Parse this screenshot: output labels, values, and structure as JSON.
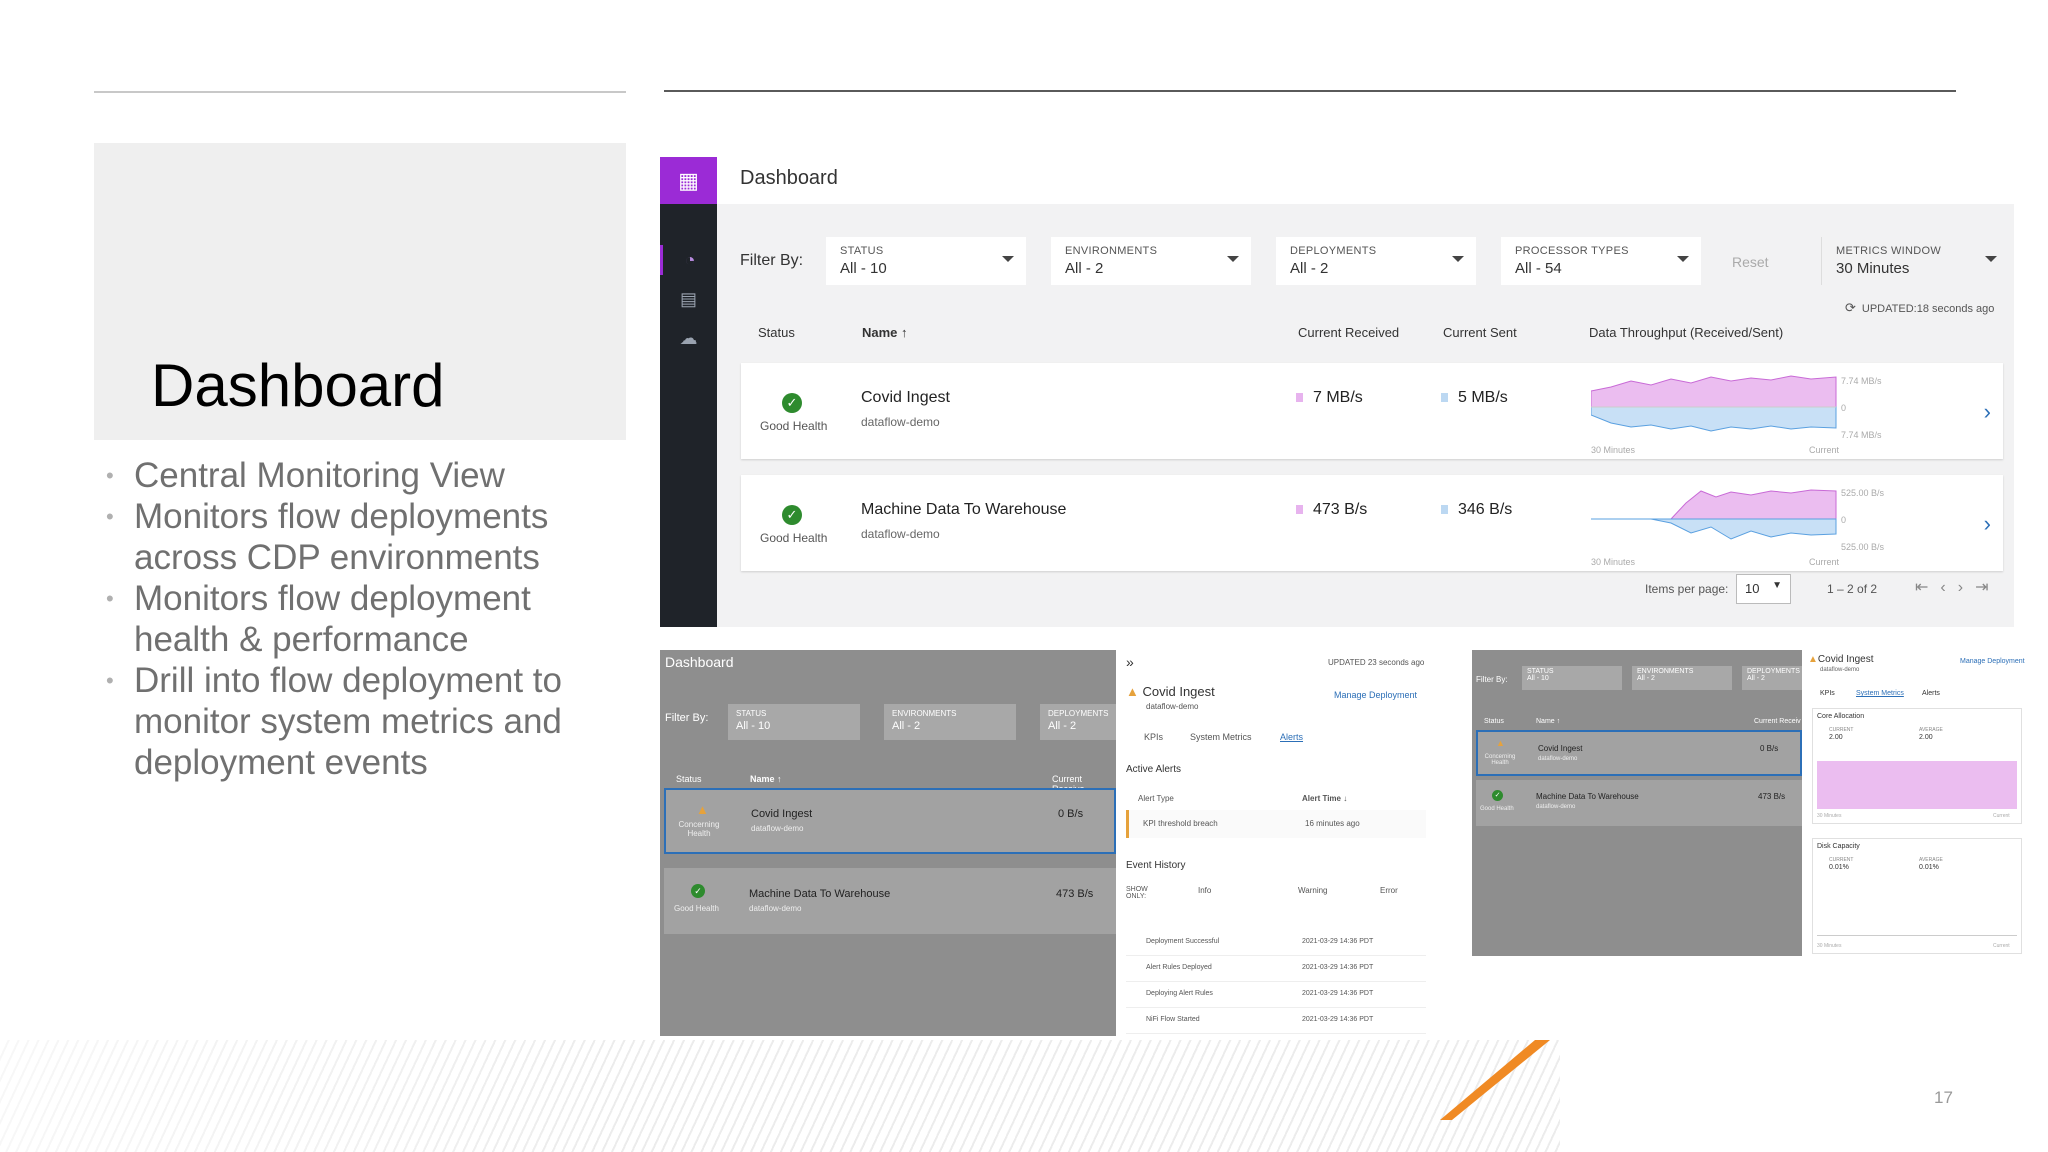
{
  "slide": {
    "title": "Dashboard",
    "bullets": [
      "Central Monitoring View",
      "Monitors flow deployments across CDP environments",
      "Monitors flow deployment health & performance",
      "Drill into flow deployment to monitor system metrics and deployment events"
    ],
    "page_number": "17"
  },
  "app": {
    "title": "Dashboard",
    "filter_label": "Filter By:",
    "filters": [
      {
        "key": "STATUS",
        "value": "All - 10"
      },
      {
        "key": "ENVIRONMENTS",
        "value": "All - 2"
      },
      {
        "key": "DEPLOYMENTS",
        "value": "All - 2"
      },
      {
        "key": "PROCESSOR TYPES",
        "value": "All - 54"
      }
    ],
    "reset": "Reset",
    "metrics_window": {
      "key": "METRICS WINDOW",
      "value": "30 Minutes"
    },
    "updated": "UPDATED:18 seconds ago",
    "columns": [
      "Status",
      "Name ↑",
      "Current Received",
      "Current Sent",
      "Data Throughput (Received/Sent)"
    ],
    "rows": [
      {
        "status": "Good Health",
        "name": "Covid Ingest",
        "env": "dataflow-demo",
        "received": "7 MB/s",
        "sent": "5 MB/s",
        "top": "7.74 MB/s",
        "zero": "0",
        "bottom": "7.74 MB/s",
        "left": "30 Minutes",
        "right": "Current"
      },
      {
        "status": "Good Health",
        "name": "Machine Data To Warehouse",
        "env": "dataflow-demo",
        "received": "473 B/s",
        "sent": "346 B/s",
        "top": "525.00 B/s",
        "zero": "0",
        "bottom": "525.00 B/s",
        "left": "30 Minutes",
        "right": "Current"
      }
    ],
    "items_per_page_label": "Items per page:",
    "items_per_page": "10",
    "range": "1 – 2 of 2",
    "colors": {
      "accent": "#9b2bd6",
      "rail": "#1f2329",
      "received": "#e7b3ee",
      "sent": "#bcd8f2",
      "link": "#2c6fb7",
      "ok": "#2e8b2e",
      "warn": "#e6a23c",
      "brand_orange": "#f08a24"
    }
  },
  "shot1": {
    "title": "Dashboard",
    "filter_label": "Filter By:",
    "filters": [
      {
        "key": "STATUS",
        "value": "All - 10"
      },
      {
        "key": "ENVIRONMENTS",
        "value": "All - 2"
      },
      {
        "key": "DEPLOYMENTS",
        "value": "All - 2"
      }
    ],
    "col_status": "Status",
    "col_name": "Name ↑",
    "col_recv": "Current Receive",
    "rows": [
      {
        "status": "Concerning Health",
        "name": "Covid Ingest",
        "env": "dataflow-demo",
        "recv": "0 B/s"
      },
      {
        "status": "Good Health",
        "name": "Machine Data To Warehouse",
        "env": "dataflow-demo",
        "recv": "473 B/s"
      }
    ]
  },
  "shot2": {
    "updated": "UPDATED 23 seconds ago",
    "name": "Covid Ingest",
    "env": "dataflow-demo",
    "manage": "Manage Deployment",
    "tabs": [
      "KPIs",
      "System Metrics",
      "Alerts"
    ],
    "active_alerts": "Active Alerts",
    "alert_cols": [
      "Alert Type",
      "Alert Time ↓"
    ],
    "alert": {
      "type": "KPI threshold breach",
      "time": "16 minutes ago"
    },
    "event_history": "Event History",
    "show_only": "SHOW ONLY:",
    "levels": [
      "Info",
      "Warning",
      "Error"
    ],
    "events": [
      {
        "name": "Deployment Successful",
        "time": "2021-03-29 14:36 PDT"
      },
      {
        "name": "Alert Rules Deployed",
        "time": "2021-03-29 14:36 PDT"
      },
      {
        "name": "Deploying Alert Rules",
        "time": "2021-03-29 14:36 PDT"
      },
      {
        "name": "NiFi Flow Started",
        "time": "2021-03-29 14:36 PDT"
      }
    ]
  },
  "shot3": {
    "filter_label": "Filter By:",
    "filters": [
      {
        "key": "STATUS",
        "value": "All - 10"
      },
      {
        "key": "ENVIRONMENTS",
        "value": "All - 2"
      },
      {
        "key": "DEPLOYMENTS",
        "value": "All - 2"
      }
    ],
    "col_status": "Status",
    "col_name": "Name ↑",
    "col_recv": "Current Receiv",
    "rows": [
      {
        "status": "Concerning Health",
        "name": "Covid Ingest",
        "env": "dataflow-demo",
        "recv": "0 B/s"
      },
      {
        "status": "Good Health",
        "name": "Machine Data To Warehouse",
        "env": "dataflow-demo",
        "recv": "473 B/s"
      }
    ]
  },
  "shot4": {
    "name": "Covid Ingest",
    "env": "dataflow-demo",
    "manage": "Manage Deployment",
    "tabs": [
      "KPIs",
      "System Metrics",
      "Alerts"
    ],
    "core": {
      "title": "Core Allocation",
      "current_label": "CURRENT",
      "current": "2.00",
      "average_label": "AVERAGE",
      "average": "2.00",
      "left": "30 Minutes",
      "right": "Current"
    },
    "disk": {
      "title": "Disk Capacity",
      "current_label": "CURRENT",
      "current": "0.01%",
      "average_label": "AVERAGE",
      "average": "0.01%",
      "left": "30 Minutes",
      "right": "Current"
    }
  }
}
